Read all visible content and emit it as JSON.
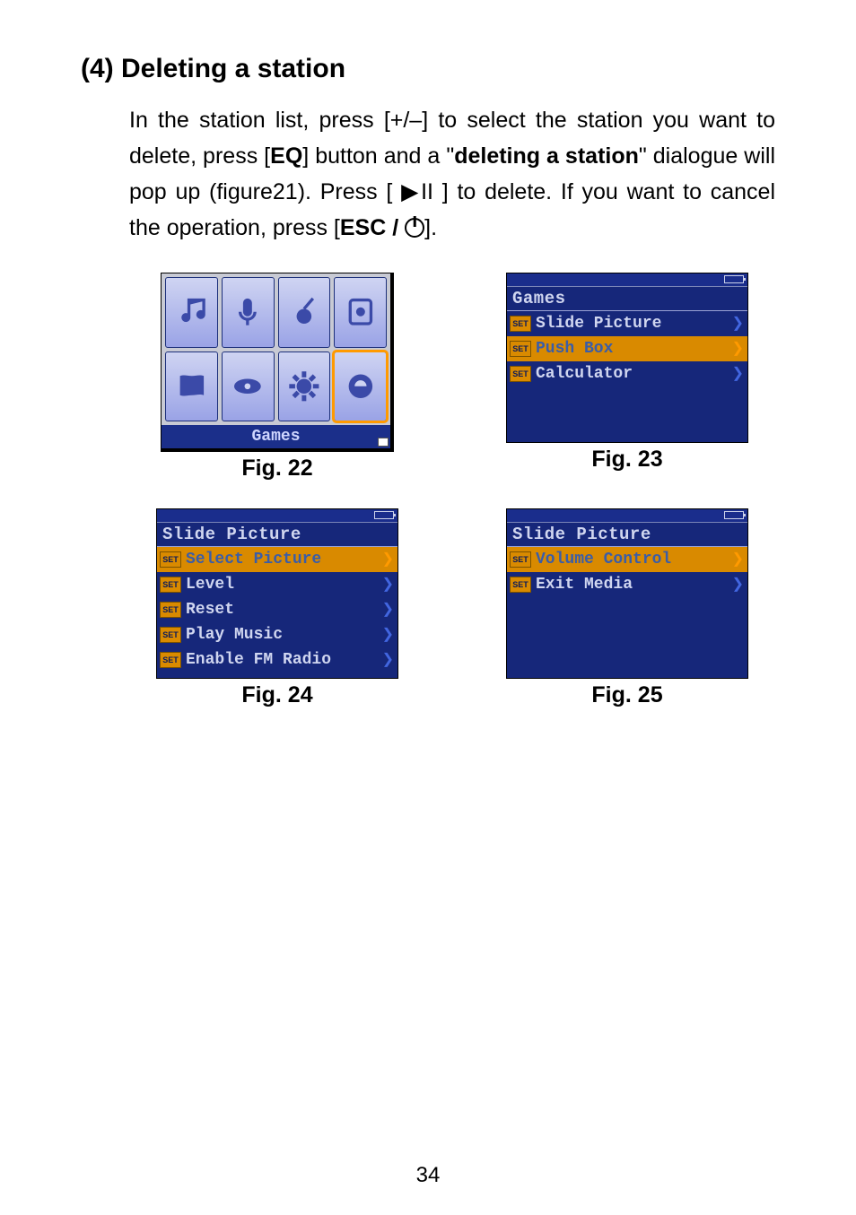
{
  "heading": "(4) Deleting a station",
  "para": {
    "t1": "In the station list, press [+/–] to select the station you want to delete, press [",
    "eq": "EQ",
    "t2": "] button and a \"",
    "del": "deleting a station",
    "t3": "\" dialogue will pop up (figure21). Press [ ",
    "play": "▶II",
    "t4": " ] to delete. If you want to cancel the operation, press [",
    "esc": "ESC / ",
    "t5": "]."
  },
  "fig22": {
    "caption": "Fig. 22",
    "label": "Games"
  },
  "fig23": {
    "caption": "Fig. 23",
    "title": "Games",
    "items": [
      {
        "label": "Slide Picture",
        "sel": false
      },
      {
        "label": "Push Box",
        "sel": true
      },
      {
        "label": "Calculator",
        "sel": false
      }
    ]
  },
  "fig24": {
    "caption": "Fig. 24",
    "title": "Slide Picture",
    "items": [
      {
        "label": "Select Picture",
        "sel": true
      },
      {
        "label": "Level",
        "sel": false
      },
      {
        "label": "Reset",
        "sel": false
      },
      {
        "label": "Play Music",
        "sel": false
      },
      {
        "label": "Enable FM Radio",
        "sel": false
      }
    ]
  },
  "fig25": {
    "caption": "Fig. 25",
    "title": "Slide Picture",
    "items": [
      {
        "label": "Volume Control",
        "sel": true
      },
      {
        "label": "Exit Media",
        "sel": false
      }
    ]
  },
  "pagenum": "34",
  "set_tag": "SET"
}
